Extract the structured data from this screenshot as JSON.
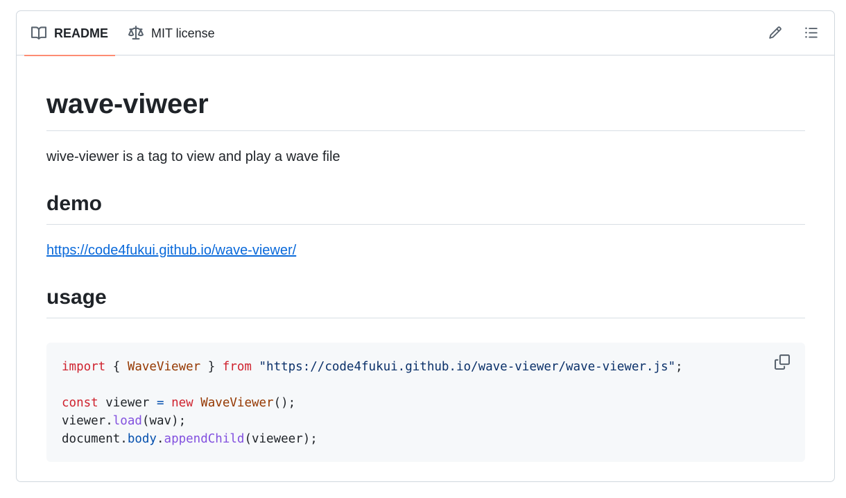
{
  "tabs": {
    "readme_label": "README",
    "license_label": "MIT license"
  },
  "header_actions": {
    "edit_icon": "pencil-icon",
    "outline_icon": "list-unordered-icon"
  },
  "readme": {
    "title": "wave-viweer",
    "description": "wive-viewer is a tag to view and play a wave file",
    "demo_heading": "demo",
    "demo_link": "https://code4fukui.github.io/wave-viewer/",
    "usage_heading": "usage",
    "code": {
      "l1_import": "import",
      "l1_open": " { ",
      "l1_class": "WaveViewer",
      "l1_close": " } ",
      "l1_from": "from",
      "l1_space": " ",
      "l1_string": "\"https://code4fukui.github.io/wave-viewer/wave-viewer.js\"",
      "l1_semi": ";",
      "l3_const": "const",
      "l3_var": " viewer ",
      "l3_eq": "=",
      "l3_space": " ",
      "l3_new": "new",
      "l3_space2": " ",
      "l3_class": "WaveViewer",
      "l3_end": "();",
      "l4_obj": "viewer.",
      "l4_fn": "load",
      "l4_args": "(wav);",
      "l5_obj": "document.",
      "l5_prop": "body",
      "l5_dot": ".",
      "l5_fn": "appendChild",
      "l5_args": "(vieweer);"
    },
    "copy_icon": "copy-icon"
  },
  "colors": {
    "tab_underline": "#fd8c73",
    "link": "#0969da",
    "code_bg": "#f6f8fa",
    "border": "#d0d7de"
  }
}
